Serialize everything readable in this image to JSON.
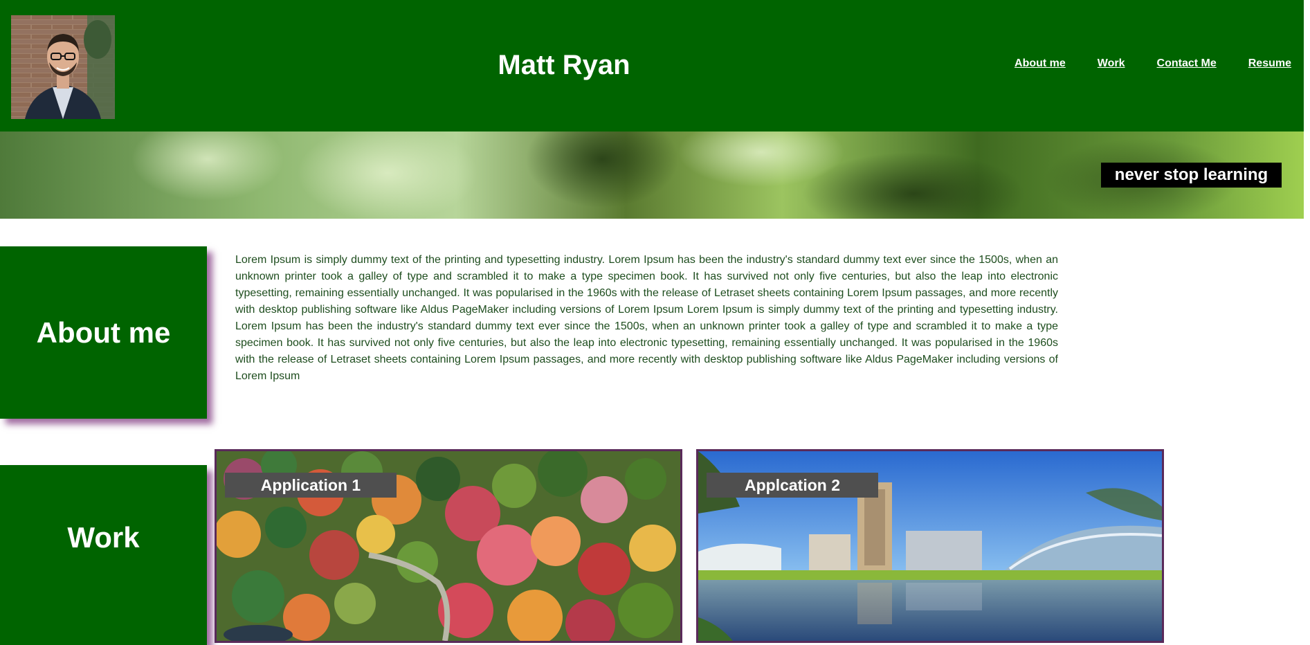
{
  "header": {
    "title": "Matt Ryan",
    "nav": [
      {
        "label": "About me"
      },
      {
        "label": "Work"
      },
      {
        "label": "Contact Me"
      },
      {
        "label": "Resume"
      }
    ]
  },
  "banner": {
    "tagline": "never stop learning"
  },
  "about": {
    "heading": "About me",
    "body": "Lorem Ipsum is simply dummy text of the printing and typesetting industry. Lorem Ipsum has been the industry's standard dummy text ever since the 1500s, when an unknown printer took a galley of type and scrambled it to make a type specimen book. It has survived not only five centuries, but also the leap into electronic typesetting, remaining essentially unchanged. It was popularised in the 1960s with the release of Letraset sheets containing Lorem Ipsum passages, and more recently with desktop publishing software like Aldus PageMaker including versions of Lorem Ipsum Lorem Ipsum is simply dummy text of the printing and typesetting industry. Lorem Ipsum has been the industry's standard dummy text ever since the 1500s, when an unknown printer took a galley of type and scrambled it to make a type specimen book. It has survived not only five centuries, but also the leap into electronic typesetting, remaining essentially unchanged. It was popularised in the 1960s with the release of Letraset sheets containing Lorem Ipsum passages, and more recently with desktop publishing software like Aldus PageMaker including versions of Lorem Ipsum"
  },
  "work": {
    "heading": "Work",
    "cards": [
      {
        "label": "Application 1"
      },
      {
        "label": "Applcation 2"
      }
    ]
  },
  "colors": {
    "primary_green": "#006400",
    "shadow_purple": "#6e1e6e",
    "label_gray": "#4f4f4f"
  }
}
